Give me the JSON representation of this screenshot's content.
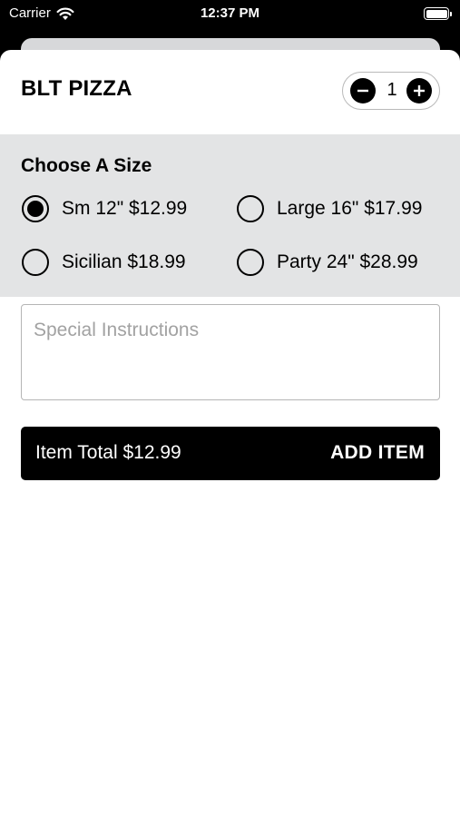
{
  "status_bar": {
    "carrier": "Carrier",
    "time": "12:37 PM",
    "icons": [
      "wifi-icon",
      "battery-icon"
    ]
  },
  "item": {
    "title": "BLT PIZZA",
    "quantity": "1"
  },
  "size_section": {
    "heading": "Choose A Size",
    "options": [
      {
        "label": "Sm 12\" $12.99",
        "selected": true
      },
      {
        "label": "Large 16\" $17.99",
        "selected": false
      },
      {
        "label": "Sicilian $18.99",
        "selected": false
      },
      {
        "label": "Party 24\" $28.99",
        "selected": false
      }
    ]
  },
  "instructions": {
    "placeholder": "Special Instructions"
  },
  "footer": {
    "item_total": "Item Total $12.99",
    "add_label": "ADD ITEM"
  },
  "colors": {
    "primary": "#000000",
    "section_bg": "#e3e4e5",
    "placeholder": "#a2a2a2"
  }
}
